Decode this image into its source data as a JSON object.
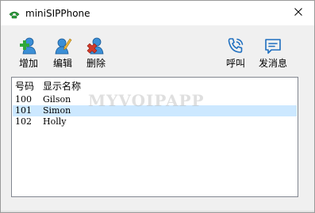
{
  "window": {
    "title": "miniSIPPhone",
    "close_glyph": "✕"
  },
  "toolbar": {
    "add_label": "增加",
    "edit_label": "编辑",
    "delete_label": "删除",
    "call_label": "呼叫",
    "message_label": "发消息"
  },
  "contacts": {
    "columns": [
      "号码",
      "显示名称"
    ],
    "rows": [
      {
        "number": "100",
        "name": "Gilson"
      },
      {
        "number": "101",
        "name": "Simon"
      },
      {
        "number": "102",
        "name": "Holly"
      }
    ],
    "selected_index": 1
  },
  "watermark": "MYVOIPAPP",
  "colors": {
    "selection": "#cce8ff",
    "phone_accent": "#1f6fbf",
    "add_green": "#2fa83a",
    "delete_red": "#d23a2a"
  }
}
